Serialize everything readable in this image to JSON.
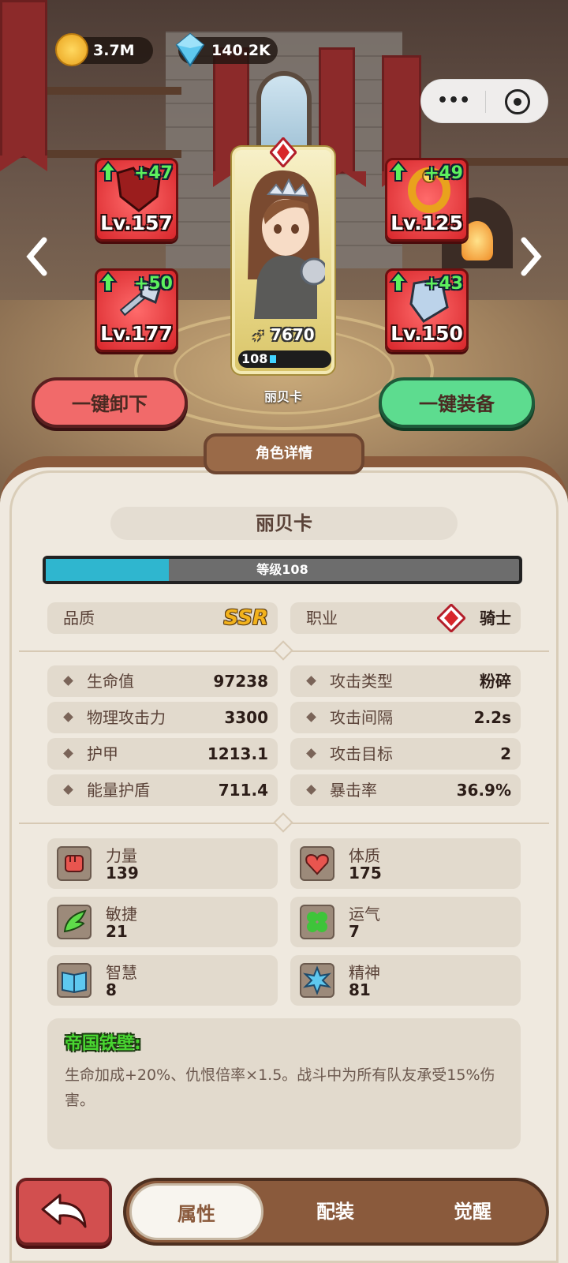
{
  "currency": {
    "gold": "3.7M",
    "gems": "140.2K"
  },
  "equipment": [
    {
      "level": "Lv.157",
      "bonus": "+47"
    },
    {
      "level": "Lv.177",
      "bonus": "+50"
    },
    {
      "level": "Lv.125",
      "bonus": "+49"
    },
    {
      "level": "Lv.150",
      "bonus": "+43"
    }
  ],
  "hero": {
    "power": "7670",
    "level_num": "108",
    "name": "丽贝卡",
    "level_progress": 0.26
  },
  "buttons": {
    "unequip_all": "一键卸下",
    "equip_all": "一键装备"
  },
  "panel": {
    "section_title": "角色详情",
    "name": "丽贝卡",
    "level_label": "等级108",
    "quality_label": "品质",
    "quality_value": "SSR",
    "class_label": "职业",
    "class_value": "骑士",
    "stats_left": [
      {
        "k": "生命值",
        "v": "97238"
      },
      {
        "k": "物理攻击力",
        "v": "3300"
      },
      {
        "k": "护甲",
        "v": "1213.1"
      },
      {
        "k": "能量护盾",
        "v": "711.4"
      }
    ],
    "stats_right": [
      {
        "k": "攻击类型",
        "v": "粉碎"
      },
      {
        "k": "攻击间隔",
        "v": "2.2s"
      },
      {
        "k": "攻击目标",
        "v": "2"
      },
      {
        "k": "暴击率",
        "v": "36.9%"
      }
    ],
    "attributes": [
      {
        "k": "力量",
        "v": "139",
        "icon": "fist-icon"
      },
      {
        "k": "体质",
        "v": "175",
        "icon": "heart-icon"
      },
      {
        "k": "敏捷",
        "v": "21",
        "icon": "wing-icon"
      },
      {
        "k": "运气",
        "v": "7",
        "icon": "clover-icon"
      },
      {
        "k": "智慧",
        "v": "8",
        "icon": "book-icon"
      },
      {
        "k": "精神",
        "v": "81",
        "icon": "spirit-icon"
      }
    ],
    "skill": {
      "title": "帝国铁壁:",
      "desc": "生命加成+20%、仇恨倍率×1.5。战斗中为所有队友承受15%伤害。"
    }
  },
  "tabs": [
    "属性",
    "配装",
    "觉醒"
  ]
}
